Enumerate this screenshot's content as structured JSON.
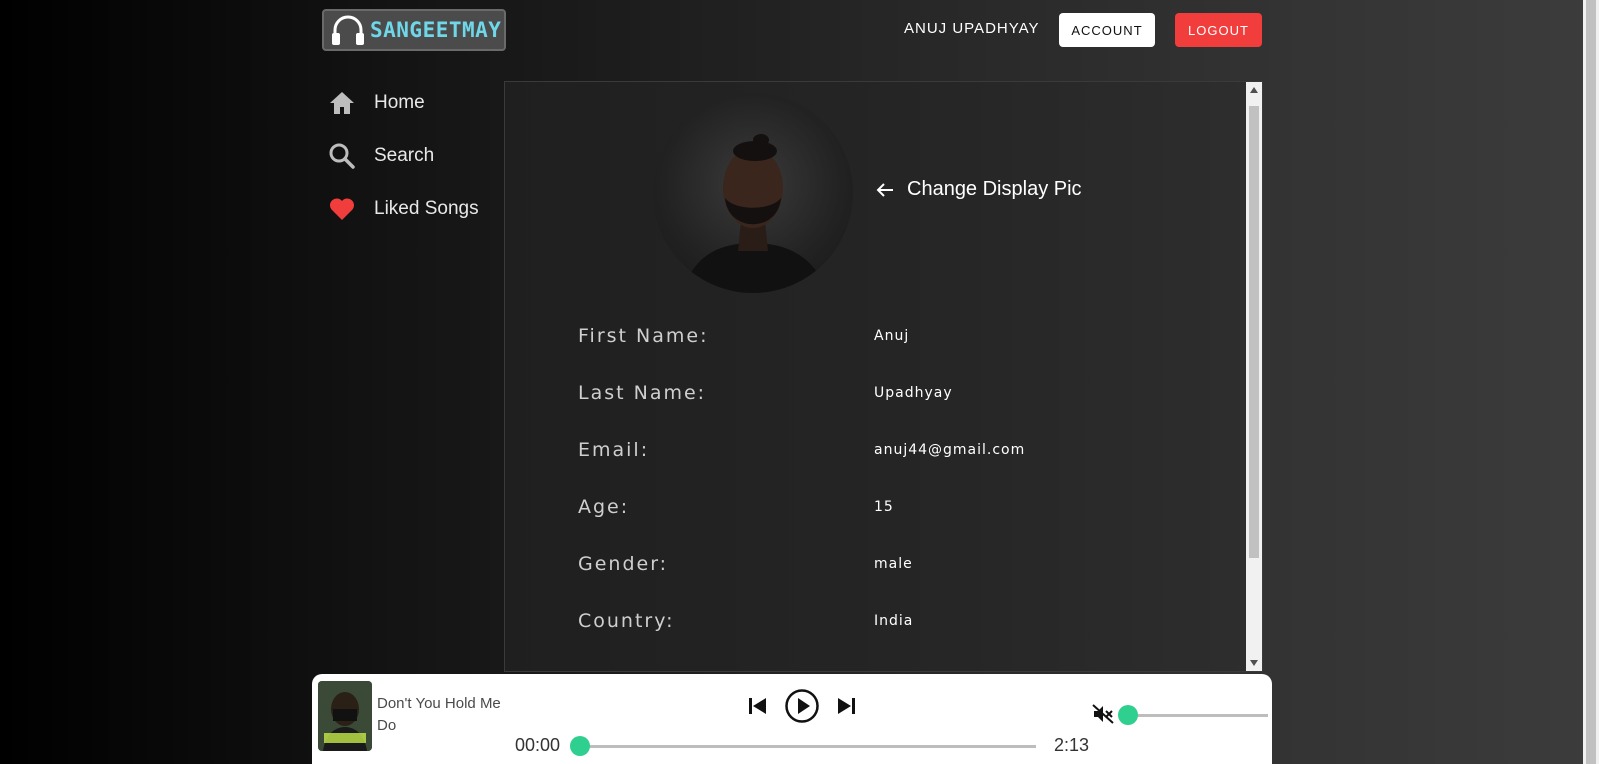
{
  "header": {
    "logo_text": "SANGEETMAY",
    "user_name": "ANUJ UPADHYAY",
    "account_label": "ACCOUNT",
    "logout_label": "LOGOUT"
  },
  "sidebar": {
    "items": [
      {
        "label": "Home",
        "icon": "home-icon"
      },
      {
        "label": "Search",
        "icon": "search-icon"
      },
      {
        "label": "Liked Songs",
        "icon": "heart-icon"
      }
    ]
  },
  "profile": {
    "change_pic_label": "Change Display Pic",
    "fields": [
      {
        "label": "First Name:",
        "value": "Anuj"
      },
      {
        "label": "Last Name:",
        "value": "Upadhyay"
      },
      {
        "label": "Email:",
        "value": "anuj44@gmail.com"
      },
      {
        "label": "Age:",
        "value": "15"
      },
      {
        "label": "Gender:",
        "value": "male"
      },
      {
        "label": "Country:",
        "value": "India"
      }
    ]
  },
  "player": {
    "song_title": "Don't You Hold Me Do",
    "current_time": "00:00",
    "total_time": "2:13",
    "progress": 0,
    "volume": 0,
    "muted": true
  },
  "colors": {
    "accent": "#2fd08f",
    "logout": "#f23d3d",
    "logo": "#6fd7e8",
    "heart": "#f23d3d"
  }
}
